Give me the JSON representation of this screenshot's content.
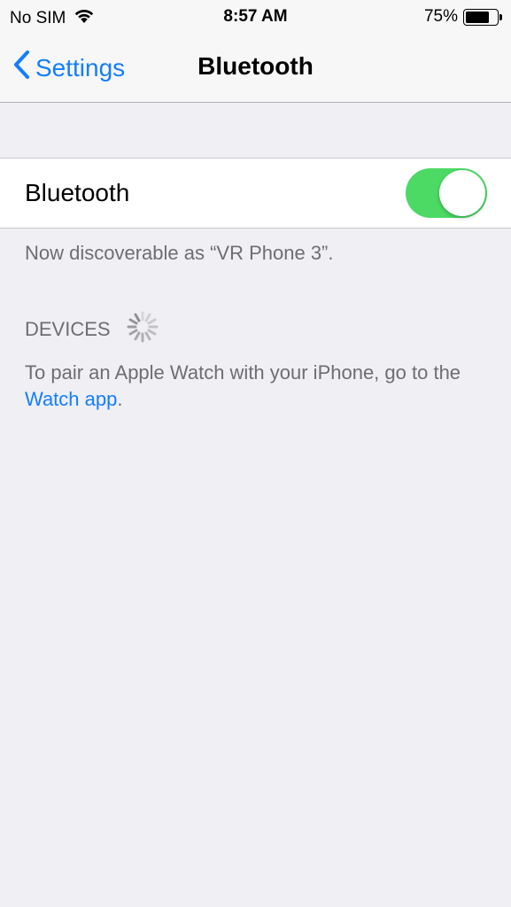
{
  "status_bar": {
    "carrier": "No SIM",
    "time": "8:57 AM",
    "battery_percent": "75%",
    "battery_level": 0.75,
    "wifi_icon": "wifi-icon",
    "battery_icon": "battery-icon"
  },
  "nav": {
    "back_label": "Settings",
    "title": "Bluetooth",
    "back_icon": "chevron-left-icon"
  },
  "bluetooth_cell": {
    "label": "Bluetooth",
    "toggle_on": true,
    "toggle_color": "#4cd964"
  },
  "discoverable_text": "Now discoverable as “VR Phone 3”.",
  "devices_section": {
    "header": "DEVICES",
    "spinner_icon": "loading-spinner-icon"
  },
  "pair_hint": {
    "prefix": "To pair an Apple Watch with your iPhone, go to the ",
    "link": "Watch app",
    "suffix": "."
  },
  "colors": {
    "accent": "#147efb",
    "background": "#efeff4",
    "secondary_text": "#6d6d72"
  }
}
